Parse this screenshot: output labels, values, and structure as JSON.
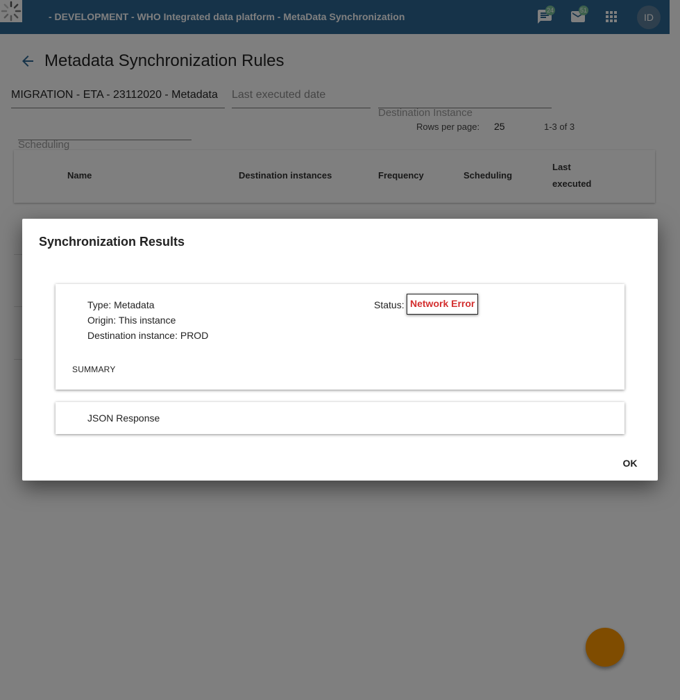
{
  "header": {
    "title": "- DEVELOPMENT - WHO Integrated data platform - MetaData Synchronization",
    "interpretations_count": "24",
    "messages_count": "51",
    "avatar_initials": "ID",
    "background_color": "#2c6693"
  },
  "page": {
    "title": "Metadata Synchronization Rules"
  },
  "filters": {
    "rule_value": "MIGRATION - ETA - 23112020 - Metadata",
    "last_executed_placeholder": "Last executed date",
    "destination_instance_label": "Destination Instance",
    "scheduling_label": "Scheduling"
  },
  "pagination": {
    "rows_per_page_label": "Rows per page:",
    "rows_per_page_value": "25",
    "range": "1-3 of 3"
  },
  "table": {
    "columns": [
      "Name",
      "Destination instances",
      "Frequency",
      "Scheduling",
      "Last executed"
    ]
  },
  "dialog": {
    "title": "Synchronization Results",
    "type": "Type: Metadata",
    "origin": "Origin: This instance",
    "destination": "Destination instance: PROD",
    "status_label": "Status:",
    "status_value": "Network Error",
    "status_color": "#d32f2f",
    "summary_label": "SUMMARY",
    "json_response_label": "JSON Response",
    "ok_label": "OK"
  },
  "icons": {
    "spinner": "loading-spinner-icon",
    "interpretations": "chat-icon",
    "messages": "mail-icon",
    "apps": "apps-grid-icon",
    "back": "arrow-back-icon"
  }
}
